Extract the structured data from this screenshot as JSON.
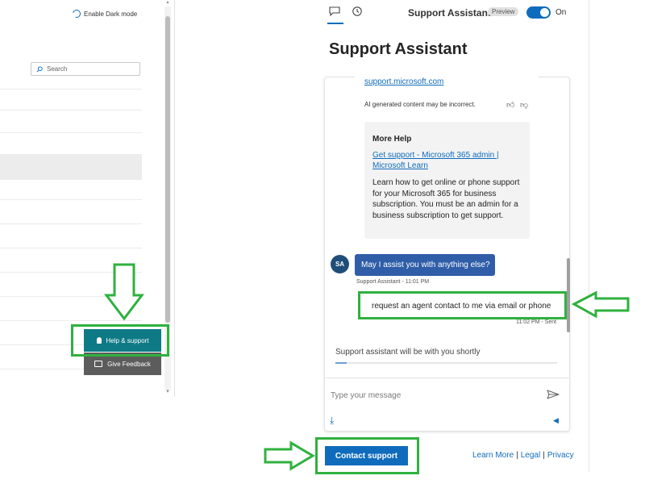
{
  "left_window": {
    "dark_mode_label": "Enable Dark mode",
    "search_placeholder": "Search",
    "help_button_label": "Help & support",
    "feedback_button_label": "Give Feedback"
  },
  "panel": {
    "assistant_name": "Support Assistant",
    "preview_badge": "Preview",
    "toggle_label": "On",
    "toggle_on": true,
    "title": "Support Assistant"
  },
  "chat": {
    "prev_link": "support.microsoft.com",
    "ai_disclaimer": "AI generated content may be incorrect.",
    "more_help": {
      "title": "More Help",
      "link": "Get support - Microsoft 365 admin | Microsoft Learn",
      "description": "Learn how to get online or phone support for your Microsoft 365 for business subscription. You must be an admin for a business subscription to get support."
    },
    "bot_avatar": "SA",
    "bot_message": "May I assist you with anything else?",
    "bot_meta": "Support Assistant - 11:01 PM",
    "user_message": "request an agent contact to me via email or phone",
    "user_meta": "11:02 PM - Sent",
    "status_text": "Support assistant will be with you shortly",
    "input_placeholder": "Type your message"
  },
  "footer": {
    "contact_button": "Contact support",
    "learn_more": "Learn More",
    "legal": "Legal",
    "privacy": "Privacy",
    "separator": "|"
  },
  "colors": {
    "accent": "#0f6cbd",
    "help_button": "#0e7a86",
    "feedback_button": "#5c5c5c",
    "bot_bubble": "#2f5da8",
    "highlight": "#2fb13e"
  },
  "icons": [
    "moon-icon",
    "search-icon",
    "help-icon",
    "feedback-icon",
    "chat-icon",
    "history-icon",
    "thumbs-up-icon",
    "thumbs-down-icon",
    "send-icon",
    "download-icon",
    "speaker-icon",
    "arrow-down-icon",
    "arrow-right-icon",
    "arrow-left-icon"
  ]
}
